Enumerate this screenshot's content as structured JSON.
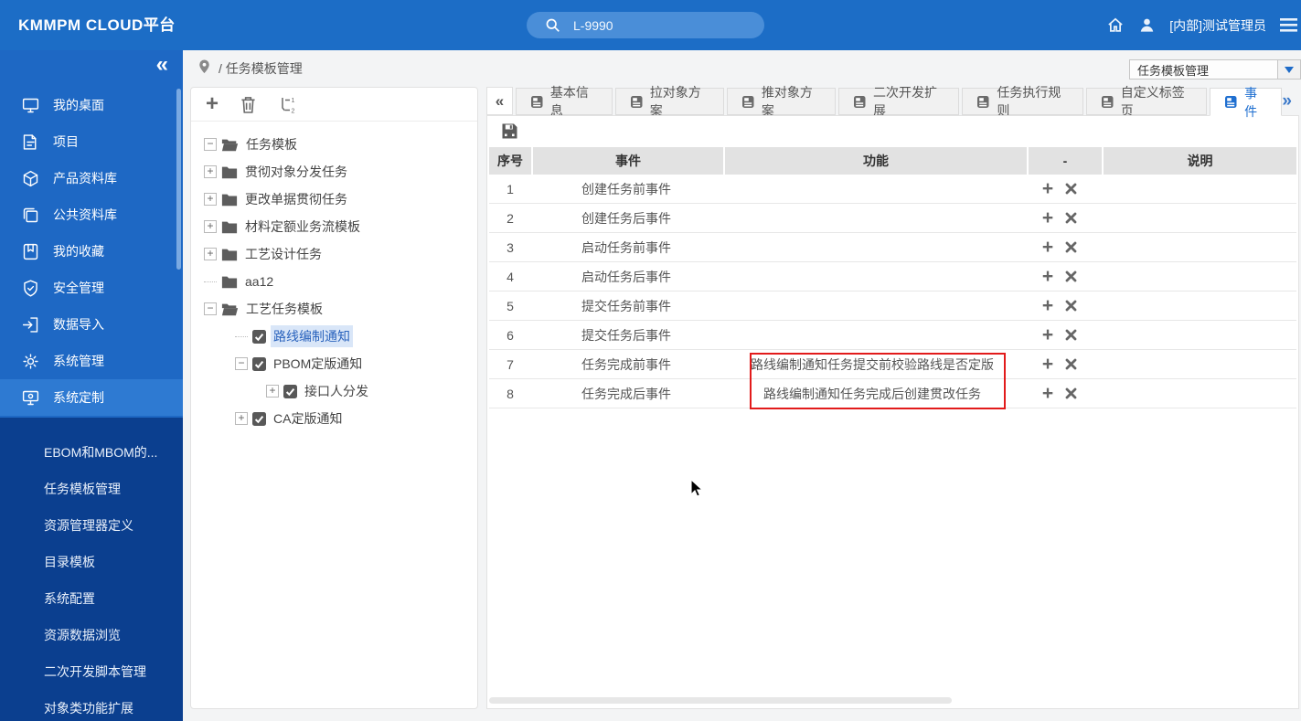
{
  "header": {
    "logo": "KMMPM CLOUD平台",
    "search_value": "L-9990",
    "user_name": "[内部]测试管理员"
  },
  "breadcrumb": {
    "path": "/ 任务模板管理"
  },
  "module_select": {
    "value": "任务模板管理"
  },
  "sidebar": {
    "collapse_glyph": "«",
    "main_items": [
      {
        "label": "我的桌面",
        "icon": "desktop-icon"
      },
      {
        "label": "项目",
        "icon": "project-icon"
      },
      {
        "label": "产品资料库",
        "icon": "product-library-icon"
      },
      {
        "label": "公共资料库",
        "icon": "public-library-icon"
      },
      {
        "label": "我的收藏",
        "icon": "favorites-icon"
      },
      {
        "label": "安全管理",
        "icon": "security-icon"
      },
      {
        "label": "数据导入",
        "icon": "data-import-icon"
      },
      {
        "label": "系统管理",
        "icon": "system-manage-icon"
      },
      {
        "label": "系统定制",
        "icon": "system-custom-icon",
        "active": true
      }
    ],
    "sub_items": [
      {
        "label": "EBOM和MBOM的..."
      },
      {
        "label": "任务模板管理"
      },
      {
        "label": "资源管理器定义"
      },
      {
        "label": "目录模板"
      },
      {
        "label": "系统配置"
      },
      {
        "label": "资源数据浏览"
      },
      {
        "label": "二次开发脚本管理"
      },
      {
        "label": "对象类功能扩展"
      }
    ]
  },
  "tree": {
    "toolbar": [
      {
        "icon": "add-icon"
      },
      {
        "icon": "delete-icon"
      },
      {
        "icon": "reorder-icon"
      }
    ],
    "nodes": [
      {
        "label": "任务模板",
        "level": 0,
        "expander": "minus",
        "icon": "folder-open"
      },
      {
        "label": "贯彻对象分发任务",
        "level": 0,
        "expander": "plus",
        "icon": "folder"
      },
      {
        "label": "更改单据贯彻任务",
        "level": 0,
        "expander": "plus",
        "icon": "folder"
      },
      {
        "label": "材料定额业务流模板",
        "level": 0,
        "expander": "plus",
        "icon": "folder"
      },
      {
        "label": "工艺设计任务",
        "level": 0,
        "expander": "plus",
        "icon": "folder"
      },
      {
        "label": "aa12",
        "level": 0,
        "expander": null,
        "icon": "folder"
      },
      {
        "label": "工艺任务模板",
        "level": 0,
        "expander": "minus",
        "icon": "folder-open"
      },
      {
        "label": "路线编制通知",
        "level": 1,
        "expander": null,
        "icon": "check",
        "selected": true
      },
      {
        "label": "PBOM定版通知",
        "level": 1,
        "expander": "minus",
        "icon": "check"
      },
      {
        "label": "接口人分发",
        "level": 2,
        "expander": "plus",
        "icon": "check"
      },
      {
        "label": "CA定版通知",
        "level": 1,
        "expander": "plus",
        "icon": "check"
      }
    ]
  },
  "tabs": {
    "scroll_left": "«",
    "scroll_right": "»",
    "items": [
      {
        "label": "基本信息"
      },
      {
        "label": "拉对象方案"
      },
      {
        "label": "推对象方案"
      },
      {
        "label": "二次开发扩展"
      },
      {
        "label": "任务执行规则"
      },
      {
        "label": "自定义标签页"
      },
      {
        "label": "事件",
        "active": true
      }
    ]
  },
  "table": {
    "columns": [
      "序号",
      "事件",
      "功能",
      "-",
      "说明"
    ],
    "rows": [
      {
        "seq": "1",
        "event": "创建任务前事件",
        "func": "",
        "note": ""
      },
      {
        "seq": "2",
        "event": "创建任务后事件",
        "func": "",
        "note": ""
      },
      {
        "seq": "3",
        "event": "启动任务前事件",
        "func": "",
        "note": ""
      },
      {
        "seq": "4",
        "event": "启动任务后事件",
        "func": "",
        "note": ""
      },
      {
        "seq": "5",
        "event": "提交任务前事件",
        "func": "",
        "note": ""
      },
      {
        "seq": "6",
        "event": "提交任务后事件",
        "func": "",
        "note": ""
      },
      {
        "seq": "7",
        "event": "任务完成前事件",
        "func": "路线编制通知任务提交前校验路线是否定版",
        "note": ""
      },
      {
        "seq": "8",
        "event": "任务完成后事件",
        "func": "路线编制通知任务完成后创建贯改任务",
        "note": ""
      }
    ],
    "highlighted_rows": [
      7,
      8
    ]
  },
  "colors": {
    "header_blue": "#1c6dc6",
    "sidebar_blue": "#1e68c4",
    "sidebar_dark_blue": "#0b3f8f",
    "active_tab_blue": "#1f6fd0",
    "highlight_red": "#e21b1b"
  }
}
